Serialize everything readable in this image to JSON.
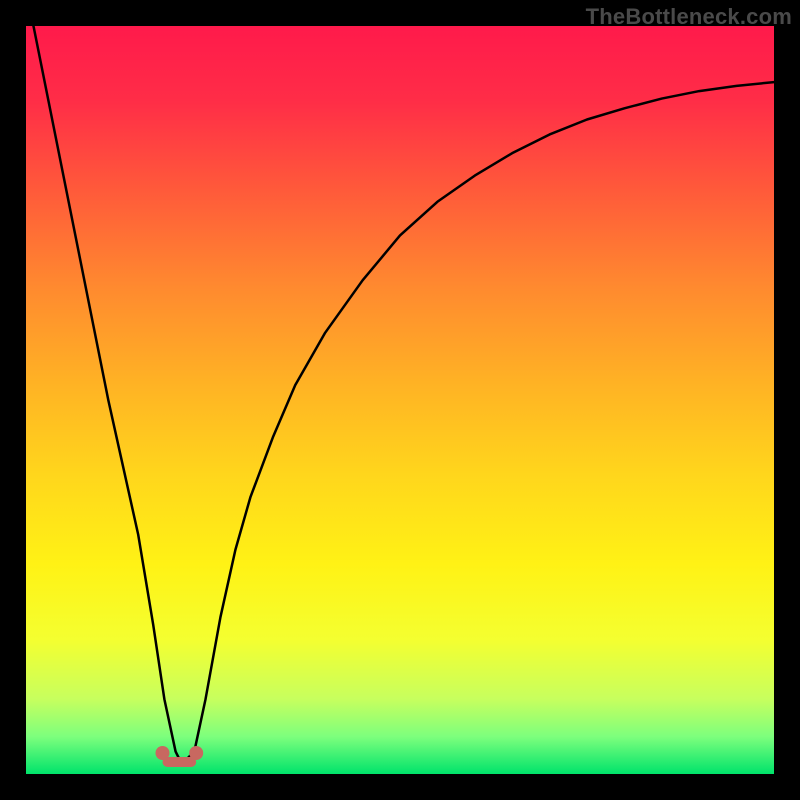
{
  "watermark": "TheBottleneck.com",
  "gradient": {
    "stops": [
      {
        "offset": 0.0,
        "color": "#ff1a4b"
      },
      {
        "offset": 0.1,
        "color": "#ff2d47"
      },
      {
        "offset": 0.22,
        "color": "#ff5a3a"
      },
      {
        "offset": 0.35,
        "color": "#ff8a2f"
      },
      {
        "offset": 0.48,
        "color": "#ffb324"
      },
      {
        "offset": 0.6,
        "color": "#ffd61c"
      },
      {
        "offset": 0.72,
        "color": "#fff215"
      },
      {
        "offset": 0.82,
        "color": "#f4ff30"
      },
      {
        "offset": 0.9,
        "color": "#c7ff5e"
      },
      {
        "offset": 0.95,
        "color": "#7dff7d"
      },
      {
        "offset": 1.0,
        "color": "#00e36b"
      }
    ]
  },
  "marker": {
    "x_frac": 0.205,
    "color": "#c86860",
    "glyph": "ꔢ",
    "width_frac": 0.045
  },
  "chart_data": {
    "type": "line",
    "title": "",
    "xlabel": "",
    "ylabel": "",
    "xlim": [
      0,
      100
    ],
    "ylim": [
      0,
      100
    ],
    "x": [
      1,
      3,
      5,
      7,
      9,
      11,
      13,
      15,
      17,
      18.5,
      20,
      20.5,
      21.5,
      22.5,
      24,
      26,
      28,
      30,
      33,
      36,
      40,
      45,
      50,
      55,
      60,
      65,
      70,
      75,
      80,
      85,
      90,
      95,
      100
    ],
    "y": [
      100,
      90,
      80,
      70,
      60,
      50,
      41,
      32,
      20,
      10,
      3,
      2,
      2,
      3,
      10,
      21,
      30,
      37,
      45,
      52,
      59,
      66,
      72,
      76.5,
      80,
      83,
      85.5,
      87.5,
      89,
      90.3,
      91.3,
      92,
      92.5
    ],
    "notch_x": 20.5,
    "notch_y": 2
  }
}
